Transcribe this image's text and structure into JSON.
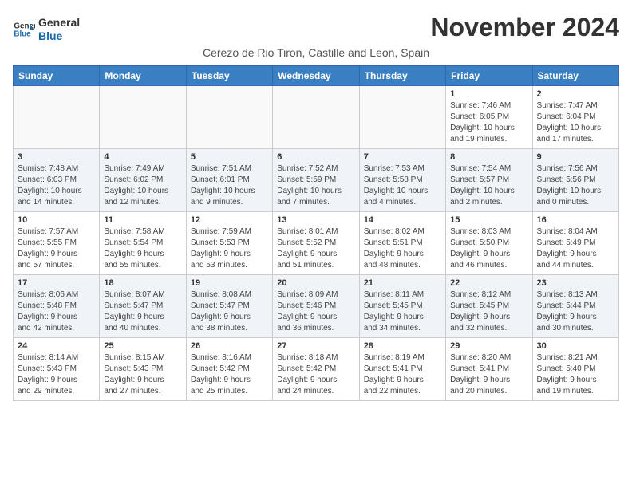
{
  "header": {
    "logo_line1": "General",
    "logo_line2": "Blue",
    "month_title": "November 2024",
    "subtitle": "Cerezo de Rio Tiron, Castille and Leon, Spain"
  },
  "weekdays": [
    "Sunday",
    "Monday",
    "Tuesday",
    "Wednesday",
    "Thursday",
    "Friday",
    "Saturday"
  ],
  "weeks": [
    [
      {
        "day": "",
        "info": ""
      },
      {
        "day": "",
        "info": ""
      },
      {
        "day": "",
        "info": ""
      },
      {
        "day": "",
        "info": ""
      },
      {
        "day": "",
        "info": ""
      },
      {
        "day": "1",
        "info": "Sunrise: 7:46 AM\nSunset: 6:05 PM\nDaylight: 10 hours\nand 19 minutes."
      },
      {
        "day": "2",
        "info": "Sunrise: 7:47 AM\nSunset: 6:04 PM\nDaylight: 10 hours\nand 17 minutes."
      }
    ],
    [
      {
        "day": "3",
        "info": "Sunrise: 7:48 AM\nSunset: 6:03 PM\nDaylight: 10 hours\nand 14 minutes."
      },
      {
        "day": "4",
        "info": "Sunrise: 7:49 AM\nSunset: 6:02 PM\nDaylight: 10 hours\nand 12 minutes."
      },
      {
        "day": "5",
        "info": "Sunrise: 7:51 AM\nSunset: 6:01 PM\nDaylight: 10 hours\nand 9 minutes."
      },
      {
        "day": "6",
        "info": "Sunrise: 7:52 AM\nSunset: 5:59 PM\nDaylight: 10 hours\nand 7 minutes."
      },
      {
        "day": "7",
        "info": "Sunrise: 7:53 AM\nSunset: 5:58 PM\nDaylight: 10 hours\nand 4 minutes."
      },
      {
        "day": "8",
        "info": "Sunrise: 7:54 AM\nSunset: 5:57 PM\nDaylight: 10 hours\nand 2 minutes."
      },
      {
        "day": "9",
        "info": "Sunrise: 7:56 AM\nSunset: 5:56 PM\nDaylight: 10 hours\nand 0 minutes."
      }
    ],
    [
      {
        "day": "10",
        "info": "Sunrise: 7:57 AM\nSunset: 5:55 PM\nDaylight: 9 hours\nand 57 minutes."
      },
      {
        "day": "11",
        "info": "Sunrise: 7:58 AM\nSunset: 5:54 PM\nDaylight: 9 hours\nand 55 minutes."
      },
      {
        "day": "12",
        "info": "Sunrise: 7:59 AM\nSunset: 5:53 PM\nDaylight: 9 hours\nand 53 minutes."
      },
      {
        "day": "13",
        "info": "Sunrise: 8:01 AM\nSunset: 5:52 PM\nDaylight: 9 hours\nand 51 minutes."
      },
      {
        "day": "14",
        "info": "Sunrise: 8:02 AM\nSunset: 5:51 PM\nDaylight: 9 hours\nand 48 minutes."
      },
      {
        "day": "15",
        "info": "Sunrise: 8:03 AM\nSunset: 5:50 PM\nDaylight: 9 hours\nand 46 minutes."
      },
      {
        "day": "16",
        "info": "Sunrise: 8:04 AM\nSunset: 5:49 PM\nDaylight: 9 hours\nand 44 minutes."
      }
    ],
    [
      {
        "day": "17",
        "info": "Sunrise: 8:06 AM\nSunset: 5:48 PM\nDaylight: 9 hours\nand 42 minutes."
      },
      {
        "day": "18",
        "info": "Sunrise: 8:07 AM\nSunset: 5:47 PM\nDaylight: 9 hours\nand 40 minutes."
      },
      {
        "day": "19",
        "info": "Sunrise: 8:08 AM\nSunset: 5:47 PM\nDaylight: 9 hours\nand 38 minutes."
      },
      {
        "day": "20",
        "info": "Sunrise: 8:09 AM\nSunset: 5:46 PM\nDaylight: 9 hours\nand 36 minutes."
      },
      {
        "day": "21",
        "info": "Sunrise: 8:11 AM\nSunset: 5:45 PM\nDaylight: 9 hours\nand 34 minutes."
      },
      {
        "day": "22",
        "info": "Sunrise: 8:12 AM\nSunset: 5:45 PM\nDaylight: 9 hours\nand 32 minutes."
      },
      {
        "day": "23",
        "info": "Sunrise: 8:13 AM\nSunset: 5:44 PM\nDaylight: 9 hours\nand 30 minutes."
      }
    ],
    [
      {
        "day": "24",
        "info": "Sunrise: 8:14 AM\nSunset: 5:43 PM\nDaylight: 9 hours\nand 29 minutes."
      },
      {
        "day": "25",
        "info": "Sunrise: 8:15 AM\nSunset: 5:43 PM\nDaylight: 9 hours\nand 27 minutes."
      },
      {
        "day": "26",
        "info": "Sunrise: 8:16 AM\nSunset: 5:42 PM\nDaylight: 9 hours\nand 25 minutes."
      },
      {
        "day": "27",
        "info": "Sunrise: 8:18 AM\nSunset: 5:42 PM\nDaylight: 9 hours\nand 24 minutes."
      },
      {
        "day": "28",
        "info": "Sunrise: 8:19 AM\nSunset: 5:41 PM\nDaylight: 9 hours\nand 22 minutes."
      },
      {
        "day": "29",
        "info": "Sunrise: 8:20 AM\nSunset: 5:41 PM\nDaylight: 9 hours\nand 20 minutes."
      },
      {
        "day": "30",
        "info": "Sunrise: 8:21 AM\nSunset: 5:40 PM\nDaylight: 9 hours\nand 19 minutes."
      }
    ]
  ]
}
